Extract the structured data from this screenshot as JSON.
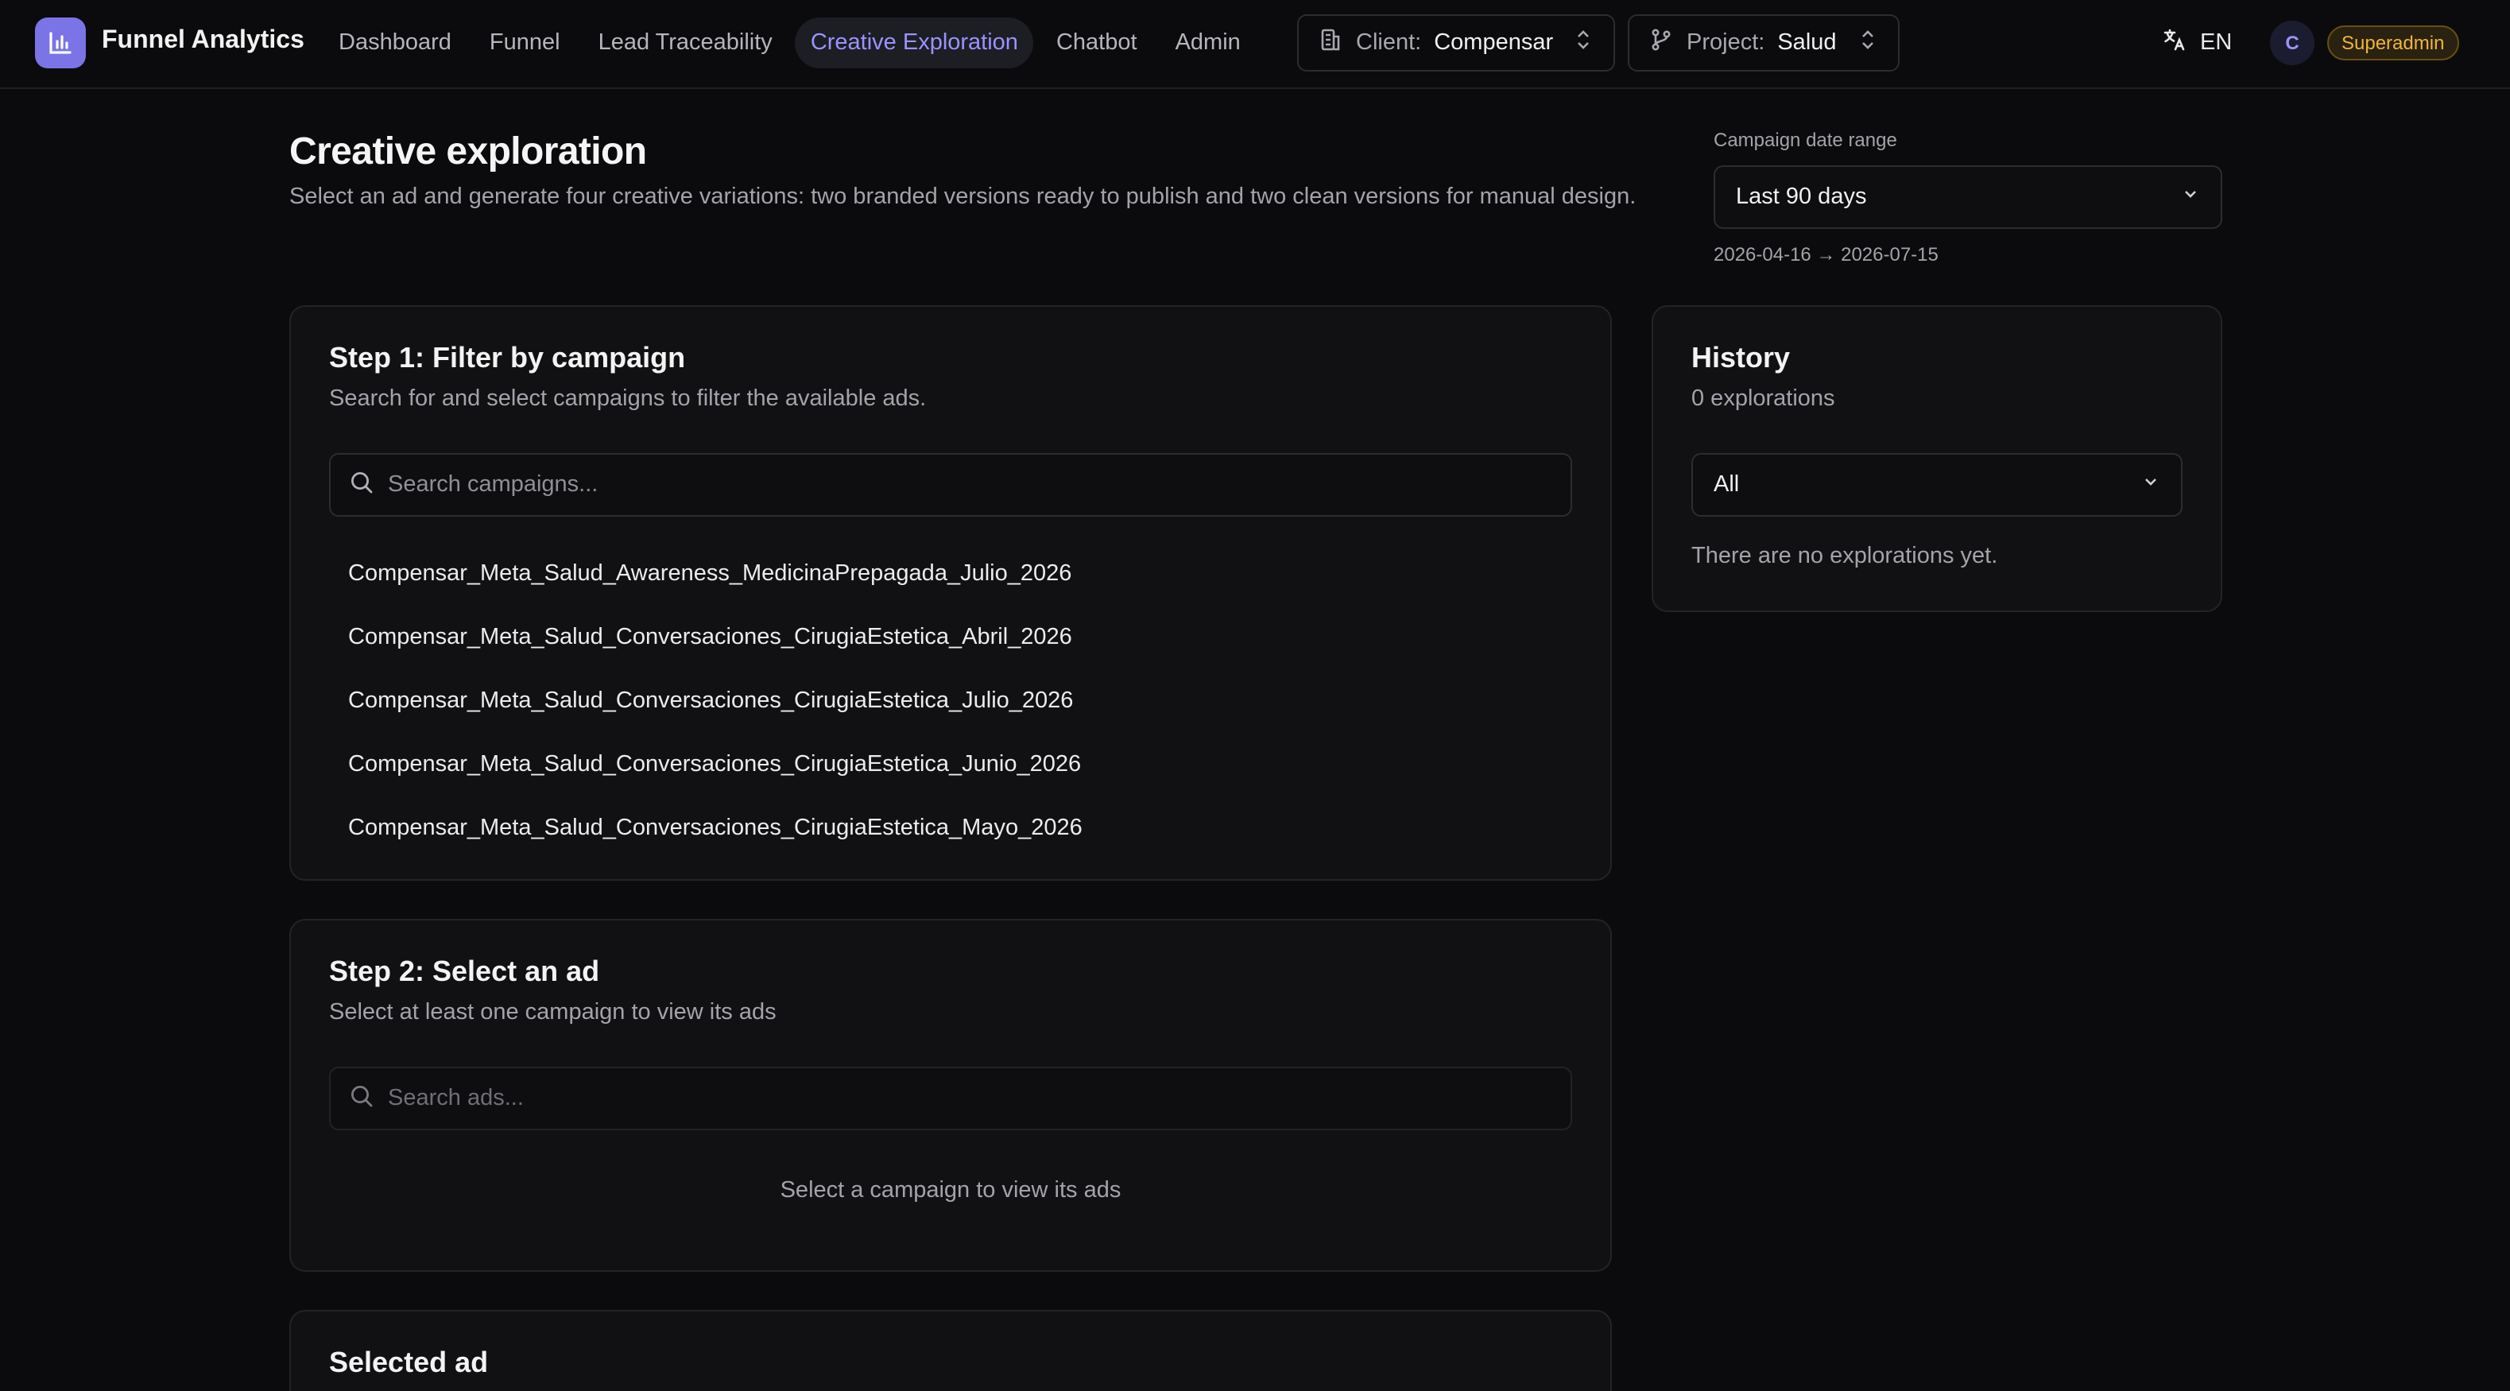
{
  "app": {
    "title": "Funnel Analytics",
    "logo_icon": "bar-chart-icon",
    "accent": "#7b74e6"
  },
  "nav": {
    "items": [
      {
        "label": "Dashboard",
        "active": false
      },
      {
        "label": "Funnel",
        "active": false
      },
      {
        "label": "Lead Traceability",
        "active": false
      },
      {
        "label": "Creative Exploration",
        "active": true
      },
      {
        "label": "Chatbot",
        "active": false
      },
      {
        "label": "Admin",
        "active": false
      }
    ]
  },
  "client_selector": {
    "label": "Client:",
    "value": "Compensar",
    "icon": "building-icon"
  },
  "project_selector": {
    "label": "Project:",
    "value": "Salud",
    "icon": "git-branch-icon"
  },
  "language": {
    "label": "EN",
    "icon": "translate-icon"
  },
  "user": {
    "initial": "C",
    "role": "Superadmin"
  },
  "page": {
    "title": "Creative exploration",
    "subtitle": "Select an ad and generate four creative variations: two branded versions ready to publish and two clean versions for manual design."
  },
  "date_range": {
    "label": "Campaign date range",
    "selected": "Last 90 days",
    "range_text": "2026-04-16 → 2026-07-15"
  },
  "step1": {
    "title": "Step 1: Filter by campaign",
    "description": "Search for and select campaigns to filter the available ads.",
    "search_placeholder": "Search campaigns...",
    "campaigns": [
      "Compensar_Meta_Salud_Awareness_MedicinaPrepagada_Julio_2026",
      "Compensar_Meta_Salud_Conversaciones_CirugiaEstetica_Abril_2026",
      "Compensar_Meta_Salud_Conversaciones_CirugiaEstetica_Julio_2026",
      "Compensar_Meta_Salud_Conversaciones_CirugiaEstetica_Junio_2026",
      "Compensar_Meta_Salud_Conversaciones_CirugiaEstetica_Mayo_2026"
    ]
  },
  "step2": {
    "title": "Step 2: Select an ad",
    "description": "Select at least one campaign to view its ads",
    "search_placeholder": "Search ads...",
    "empty": "Select a campaign to view its ads"
  },
  "selected_ad": {
    "title": "Selected ad"
  },
  "history": {
    "title": "History",
    "count_text": "0 explorations",
    "filter_value": "All",
    "empty": "There are no explorations yet."
  }
}
